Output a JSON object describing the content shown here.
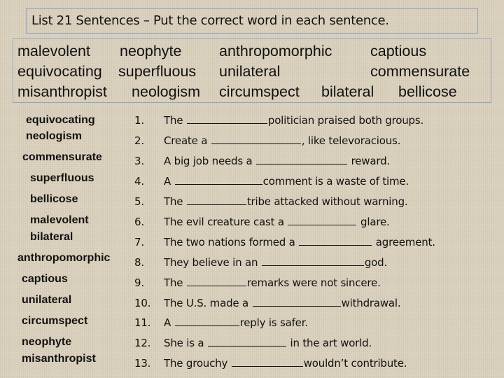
{
  "title": "List 21 Sentences – Put the correct word in each sentence.",
  "word_bank": {
    "rows": [
      [
        "malevolent",
        "neophyte",
        "anthropomorphic",
        "captious"
      ],
      [
        "equivocating",
        "superfluous",
        "unilateral",
        "commensurate"
      ],
      [
        "misanthropist",
        "neologism",
        "circumspect",
        "bilateral",
        "bellicose"
      ]
    ]
  },
  "answers": [
    "equivocating",
    "neologism",
    "commensurate",
    "superfluous",
    "bellicose",
    "malevolent",
    "bilateral",
    "anthropomorphic",
    "captious",
    "unilateral",
    "circumspect",
    "neophyte",
    "misanthropist"
  ],
  "sentences": [
    {
      "num": "1.",
      "before": "The ",
      "after": "politician praised both groups."
    },
    {
      "num": "2.",
      "before": "Create a ",
      "after": ", like televoracious."
    },
    {
      "num": "3.",
      "before": "A big job needs a ",
      "after": " reward."
    },
    {
      "num": "4.",
      "before": "A ",
      "after": "comment is a waste of time."
    },
    {
      "num": "5.",
      "before": "The ",
      "after": "tribe attacked without warning."
    },
    {
      "num": "6.",
      "before": "The evil creature cast a ",
      "after": " glare."
    },
    {
      "num": "7.",
      "before": "The two nations formed a ",
      "after": " agreement."
    },
    {
      "num": "8.",
      "before": "They believe in an ",
      "after": "god."
    },
    {
      "num": "9.",
      "before": "The ",
      "after": "remarks were not sincere."
    },
    {
      "num": "10.",
      "before": "The U.S. made a ",
      "after": "withdrawal."
    },
    {
      "num": "11.",
      "before": "A ",
      "after": "reply is safer."
    },
    {
      "num": "12.",
      "before": "She is a ",
      "after": " in the art world."
    },
    {
      "num": "13.",
      "before": "The grouchy ",
      "after": "wouldn’t contribute."
    }
  ]
}
